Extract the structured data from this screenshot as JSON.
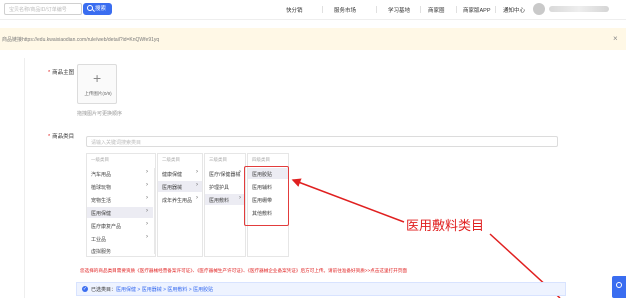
{
  "topbar": {
    "search_placeholder": "宝贝名称/商品ID/订单编号",
    "search_button": "搜索",
    "nav": [
      "快分销",
      "服务市场",
      "学习基地",
      "商家圈",
      "商家版APP",
      "通知中心"
    ],
    "user_name": "",
    "avatar_icon": "avatar-icon"
  },
  "banner": {
    "text": "商品链接https://edu.kwaixiaodian.com/rule/web/detail?id=KnQWfe91yq",
    "close_icon": "close-icon"
  },
  "form": {
    "main_image_label": "商品主图",
    "upload_label": "上传图片(0/9)",
    "drag_hint": "拖拽图片可更换顺序",
    "category_label": "商品类目",
    "category_search_placeholder": "请输入关键词搜索类目",
    "columns": {
      "level1": {
        "head": "一级类目",
        "items": [
          "汽车用品",
          "植球玩物",
          "宠物生活",
          "医用保健",
          "医疗康复产品",
          "工业品",
          "虚拟服务"
        ]
      },
      "level2": {
        "head": "二级类目",
        "items": [
          "健康保健",
          "医用器械",
          "成年养生用品"
        ]
      },
      "level3": {
        "head": "三级类目",
        "items": [
          "医疗/保健器械",
          "护理护具",
          "医用敷料"
        ]
      },
      "level4": {
        "head": "四级类目",
        "items": [
          "医用胶贴",
          "医用辅料",
          "医用绷带",
          "其他敷料"
        ]
      }
    },
    "annotation": "医用敷料类目",
    "warning": "您选择的商品类目需要资质《医疗器械经营备案许可证》、《医疗器械生产许可证》、《医疗器械企业备案凭证》后方可上传。请前往准备好资质>>点击这里打开页面",
    "selected_prefix": "已选类目：",
    "selected_path": "医用保健 > 医用器械 > 医用敷料 > 医用胶贴"
  },
  "colors": {
    "accent": "#3a6df0",
    "highlight": "#e23c3c",
    "banner_bg": "#fff8e6"
  }
}
